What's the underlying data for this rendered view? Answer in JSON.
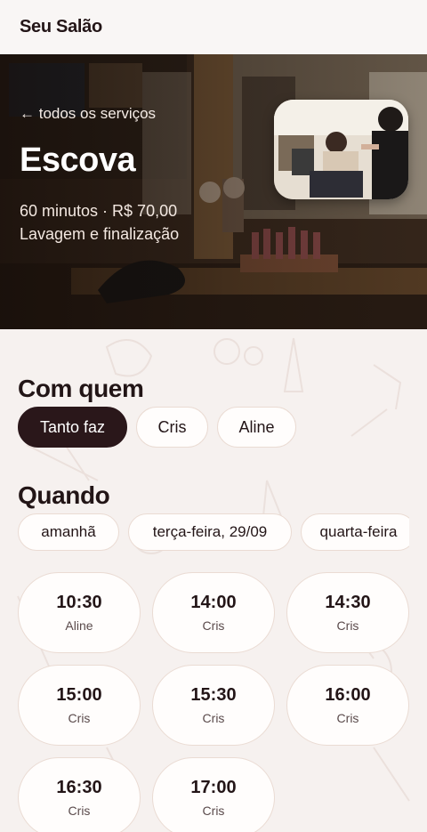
{
  "app": {
    "brand": "Seu Salão"
  },
  "hero": {
    "back_label": "← todos os serviços",
    "title": "Escova",
    "meta": "60 minutos · R$ 70,00",
    "description": "Lavagem e finalização"
  },
  "who": {
    "title": "Com quem",
    "options": [
      {
        "label": "Tanto faz",
        "selected": true
      },
      {
        "label": "Cris",
        "selected": false
      },
      {
        "label": "Aline",
        "selected": false
      }
    ]
  },
  "when": {
    "title": "Quando",
    "dates": [
      {
        "label": "amanhã"
      },
      {
        "label": "terça-feira, 29/09"
      },
      {
        "label": "quarta-feira"
      }
    ],
    "slots": [
      {
        "time": "10:30",
        "professional": "Aline"
      },
      {
        "time": "14:00",
        "professional": "Cris"
      },
      {
        "time": "14:30",
        "professional": "Cris"
      },
      {
        "time": "15:00",
        "professional": "Cris"
      },
      {
        "time": "15:30",
        "professional": "Cris"
      },
      {
        "time": "16:00",
        "professional": "Cris"
      },
      {
        "time": "16:30",
        "professional": "Cris"
      },
      {
        "time": "17:00",
        "professional": "Cris"
      }
    ]
  },
  "colors": {
    "page_bg": "#f6f1ef",
    "accent_dark": "#2a171a",
    "chip_border": "#eadbd3",
    "text": "#221516"
  }
}
